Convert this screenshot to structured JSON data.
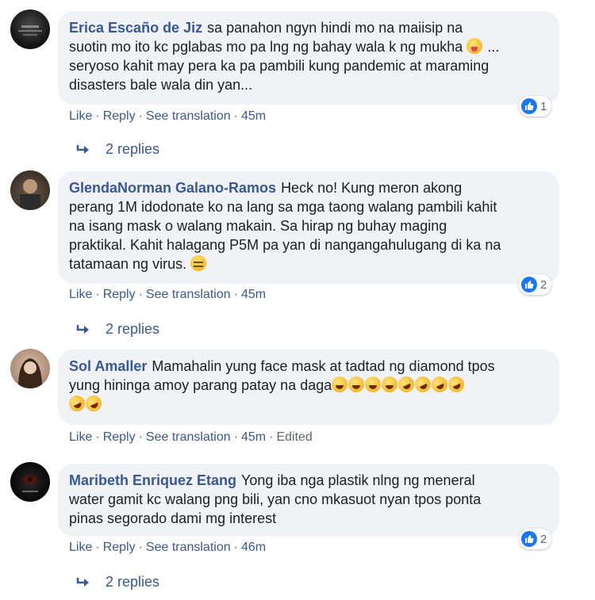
{
  "comments": [
    {
      "author": "Erica Escaño de Jiz",
      "text_lines": [
        "sa panahon ngyn hindi mo na maiisip na",
        "suotin mo ito kc pglabas mo pa lng ng bahay wala k ng mukha",
        "seryoso kahit may pera ka pa pambili kung pandemic at maraming",
        "disasters bale wala din yan..."
      ],
      "line2_suffix": " ...",
      "reaction_count": "1",
      "actions": {
        "like": "Like",
        "reply": "Reply",
        "translate": "See translation",
        "time": "45m"
      },
      "replies": "2 replies"
    },
    {
      "author": "GlendaNorman Galano-Ramos",
      "text_lines": [
        "Heck no! Kung meron akong",
        "perang 1M idodonate ko na lang sa mga taong walang pambili kahit",
        "na isang mask o walang makain. Sa hirap ng buhay maging",
        "praktikal. Kahit halagang P5M pa yan di nangangahulugang di ka na",
        "tatamaan ng virus."
      ],
      "reaction_count": "2",
      "actions": {
        "like": "Like",
        "reply": "Reply",
        "translate": "See translation",
        "time": "45m"
      },
      "replies": "2 replies"
    },
    {
      "author": "Sol Amaller",
      "text_lines": [
        "Mamahalin yung face mask at tadtad ng diamond tpos",
        "yung hininga amoy parang patay na daga"
      ],
      "actions": {
        "like": "Like",
        "reply": "Reply",
        "translate": "See translation",
        "time": "45m",
        "edited": "Edited"
      }
    },
    {
      "author": "Maribeth Enriquez Etang",
      "text_lines": [
        "Yong iba nga plastik nlng ng meneral",
        "water gamit kc walang png bili, yan cno mkasuot nyan tpos ponta",
        "pinas segorado dami mg interest"
      ],
      "reaction_count": "2",
      "actions": {
        "like": "Like",
        "reply": "Reply",
        "translate": "See translation",
        "time": "46m"
      },
      "replies": "2 replies"
    }
  ],
  "colors": {
    "link": "#385898",
    "bubble": "#f0f2f5",
    "like_blue": "#1877f2",
    "muted": "#65676b"
  },
  "icons": [
    "like-icon",
    "reply-arrow-icon",
    "emoji-icon"
  ]
}
